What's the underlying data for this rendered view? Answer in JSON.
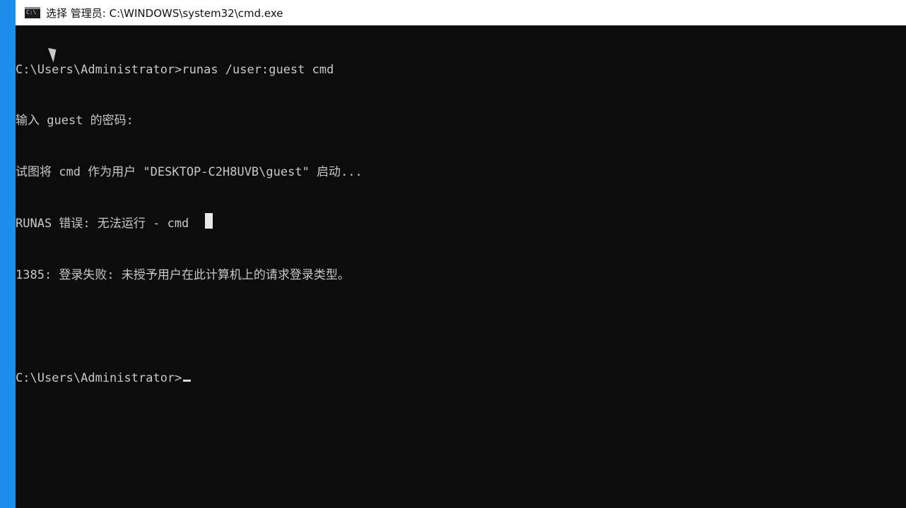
{
  "window": {
    "title": "选择 管理员: C:\\WINDOWS\\system32\\cmd.exe",
    "icon": "cmd-window-icon",
    "icon_text": "C:\\"
  },
  "console": {
    "lines": [
      "C:\\Users\\Administrator>runas /user:guest cmd",
      "输入 guest 的密码:",
      "试图将 cmd 作为用户 \"DESKTOP-C2H8UVB\\guest\" 启动...",
      "RUNAS 错误: 无法运行 - cmd",
      "1385: 登录失败: 未授予用户在此计算机上的请求登录类型。",
      "",
      "C:\\Users\\Administrator>"
    ]
  },
  "colors": {
    "console_bg": "#0c0c0c",
    "console_text": "#c8c8c8",
    "titlebar_bg": "#ffffff",
    "desktop_accent": "#1e8ee8"
  }
}
